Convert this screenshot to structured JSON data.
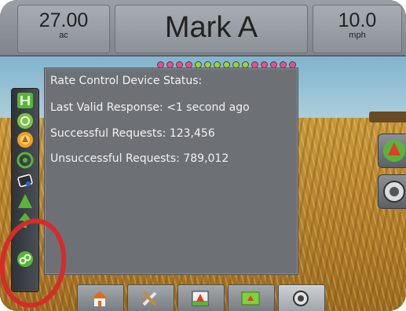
{
  "top_bar": {
    "left": {
      "value": "27.00",
      "unit": "ac"
    },
    "center": {
      "title": "Mark A"
    },
    "right": {
      "value": "10.0",
      "unit": "mph"
    }
  },
  "boom_sections": {
    "colors": [
      "#e8508a",
      "#e8508a",
      "#e8508a",
      "#e8508a",
      "#9ad23a",
      "#9ad23a",
      "#9ad23a",
      "#9ad23a",
      "#9ad23a",
      "#9ad23a",
      "#e8508a",
      "#e8508a",
      "#e8508a",
      "#e8508a",
      "#e8508a"
    ]
  },
  "status_popup": {
    "heading": "Rate Control Device Status:",
    "last_valid_response": "Last Valid Response: <1 second ago",
    "successful_requests": "Successful Requests: 123,456",
    "unsuccessful_requests": "Unsuccessful Requests: 789,012"
  },
  "left_icons": [
    "section-control-icon",
    "gps-icon",
    "rate-icon",
    "steering-icon",
    "tilt-icon",
    "nav-arrow-icon",
    "boom-icon",
    "link-status-icon"
  ],
  "right_buttons": [
    "vehicle-view-icon",
    "zoom-icon"
  ],
  "bottom_toolbar": [
    "home-icon",
    "tools-icon",
    "guidance-icon",
    "map-icon",
    "camera-icon"
  ],
  "colors": {
    "accent_green": "#59b53a",
    "annotation_red": "#d62b2b",
    "panel_gray": "#6d7176"
  }
}
